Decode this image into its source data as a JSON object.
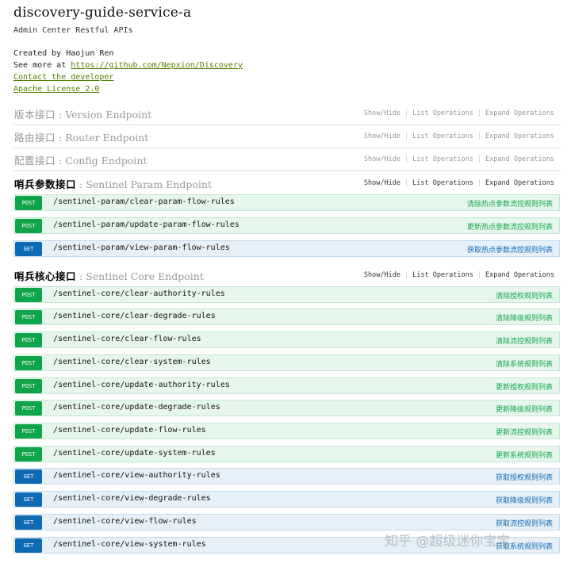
{
  "header": {
    "title": "discovery-guide-service-a",
    "subtitle": "Admin Center Restful APIs",
    "created_by": "Created by Haojun Ren",
    "see_more_prefix": "See more at ",
    "see_more_link": "https://github.com/Nepxion/Discovery",
    "contact_link": "Contact the developer",
    "license_link": "Apache License 2.0"
  },
  "ops": {
    "show_hide": "Show/Hide",
    "list": "List Operations",
    "expand": "Expand Operations"
  },
  "sections": [
    {
      "cn": "版本接口",
      "sep": " : ",
      "en": "Version Endpoint"
    },
    {
      "cn": "路由接口",
      "sep": " : ",
      "en": "Router Endpoint"
    },
    {
      "cn": "配置接口",
      "sep": " : ",
      "en": "Config Endpoint"
    },
    {
      "cn": "哨兵参数接口",
      "sep": " : ",
      "en": "Sentinel Param Endpoint"
    },
    {
      "cn": "哨兵核心接口",
      "sep": " : ",
      "en": "Sentinel Core Endpoint"
    }
  ],
  "param_endpoints": [
    {
      "method": "POST",
      "path": "/sentinel-param/clear-param-flow-rules",
      "desc": "清除热点参数流控规则列表"
    },
    {
      "method": "POST",
      "path": "/sentinel-param/update-param-flow-rules",
      "desc": "更新热点参数流控规则列表"
    },
    {
      "method": "GET",
      "path": "/sentinel-param/view-param-flow-rules",
      "desc": "获取热点参数流控规则列表"
    }
  ],
  "core_endpoints": [
    {
      "method": "POST",
      "path": "/sentinel-core/clear-authority-rules",
      "desc": "清除授权规则列表"
    },
    {
      "method": "POST",
      "path": "/sentinel-core/clear-degrade-rules",
      "desc": "清除降级规则列表"
    },
    {
      "method": "POST",
      "path": "/sentinel-core/clear-flow-rules",
      "desc": "清除流控规则列表"
    },
    {
      "method": "POST",
      "path": "/sentinel-core/clear-system-rules",
      "desc": "清除系统规则列表"
    },
    {
      "method": "POST",
      "path": "/sentinel-core/update-authority-rules",
      "desc": "更新授权规则列表"
    },
    {
      "method": "POST",
      "path": "/sentinel-core/update-degrade-rules",
      "desc": "更新降级规则列表"
    },
    {
      "method": "POST",
      "path": "/sentinel-core/update-flow-rules",
      "desc": "更新流控规则列表"
    },
    {
      "method": "POST",
      "path": "/sentinel-core/update-system-rules",
      "desc": "更新系统规则列表"
    },
    {
      "method": "GET",
      "path": "/sentinel-core/view-authority-rules",
      "desc": "获取授权规则列表"
    },
    {
      "method": "GET",
      "path": "/sentinel-core/view-degrade-rules",
      "desc": "获取降级规则列表"
    },
    {
      "method": "GET",
      "path": "/sentinel-core/view-flow-rules",
      "desc": "获取流控规则列表"
    },
    {
      "method": "GET",
      "path": "/sentinel-core/view-system-rules",
      "desc": "获取系统规则列表"
    }
  ],
  "watermark": "知乎 @超级迷你宝宝"
}
